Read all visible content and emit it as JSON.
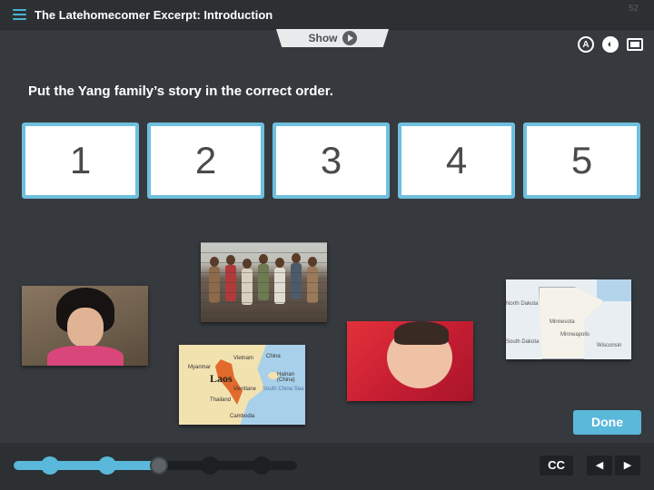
{
  "header": {
    "title": "The Latehomecomer Excerpt: Introduction",
    "page_number": "52"
  },
  "show_tab": {
    "label": "Show"
  },
  "toolbar": {
    "accessibility_glyph": "A",
    "audio_glyph": "◐"
  },
  "prompt": "Put the Yang family’s story in the correct order.",
  "slots": [
    "1",
    "2",
    "3",
    "4",
    "5"
  ],
  "images": {
    "girl": "photo of a young girl",
    "crowd": "photo of refugees behind a fence",
    "map_laos": {
      "title": "Laos",
      "labels": [
        "Myanmar",
        "Vietnam",
        "China",
        "Vientiane",
        "Thailand",
        "Cambodia",
        "Hainan (China)",
        "South China Sea"
      ]
    },
    "baby": "photo of a sleeping baby",
    "map_minnesota": {
      "labels": [
        "North Dakota",
        "South Dakota",
        "Minnesota",
        "Minneapolis",
        "Wisconsin"
      ]
    }
  },
  "done_label": "Done",
  "progress": {
    "value": 0.51,
    "steps_completed": 3,
    "steps_total": 5
  },
  "footer": {
    "cc_label": "CC",
    "prev_glyph": "◀",
    "next_glyph": "▶"
  },
  "colors": {
    "accent": "#5ab8da",
    "background": "#363a3e",
    "bar": "#2c3033"
  }
}
